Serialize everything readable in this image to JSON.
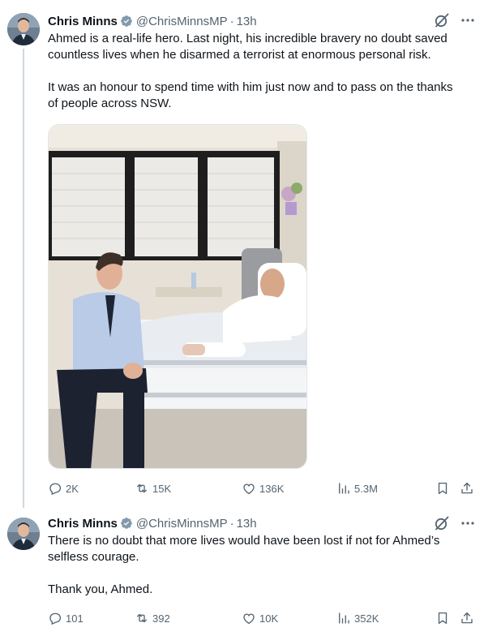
{
  "tweets": [
    {
      "author": {
        "name": "Chris Minns",
        "handle": "@ChrisMinnsMP",
        "verified": true
      },
      "time": "13h",
      "separator": "·",
      "paragraphs": [
        [
          "Ahmed is a real-life hero. Last night, his incredible bravery no doubt saved",
          "countless lives when he disarmed a terrorist at enormous personal risk."
        ],
        [
          "It was an honour to spend time with him just now and to pass on the thanks",
          "of people across NSW."
        ]
      ],
      "stats": {
        "replies": "2K",
        "reposts": "15K",
        "likes": "136K",
        "views": "5.3M"
      }
    },
    {
      "author": {
        "name": "Chris Minns",
        "handle": "@ChrisMinnsMP",
        "verified": true
      },
      "time": "13h",
      "separator": "·",
      "paragraphs": [
        [
          "There is no doubt that more lives would have been lost if not for Ahmed’s",
          "selfless courage."
        ],
        [
          "Thank you, Ahmed."
        ]
      ],
      "stats": {
        "replies": "101",
        "reposts": "392",
        "likes": "10K",
        "views": "352K"
      }
    }
  ],
  "colors": {
    "text": "#0f1419",
    "secondary": "#536471",
    "verified": "#829aab",
    "thread_line": "#cfd9de"
  },
  "icons": [
    "verified-badge-icon",
    "grok-icon",
    "more-icon",
    "reply-icon",
    "repost-icon",
    "like-icon",
    "views-icon",
    "bookmark-icon",
    "share-icon"
  ]
}
